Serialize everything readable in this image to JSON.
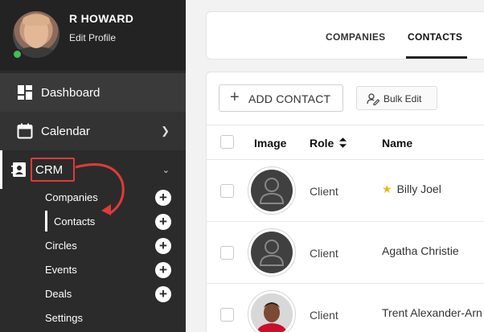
{
  "profile": {
    "name": "R HOWARD",
    "edit_label": "Edit Profile"
  },
  "nav": {
    "dashboard": "Dashboard",
    "calendar": "Calendar",
    "crm": "CRM",
    "sub_items": [
      "Companies",
      "Contacts",
      "Circles",
      "Events",
      "Deals",
      "Settings"
    ]
  },
  "tabs": {
    "companies": "COMPANIES",
    "contacts": "CONTACTS"
  },
  "toolbar": {
    "add_contact": "ADD CONTACT",
    "bulk_edit": "Bulk Edit"
  },
  "table": {
    "columns": [
      "Image",
      "Role",
      "Name"
    ],
    "rows": [
      {
        "role": "Client",
        "name": "Billy Joel",
        "starred": true
      },
      {
        "role": "Client",
        "name": "Agatha Christie",
        "starred": false
      },
      {
        "role": "Client",
        "name": "Trent Alexander-Arn",
        "starred": false
      }
    ]
  },
  "colors": {
    "sidebar": "#2b2b2b",
    "highlight": "#e03a3a",
    "star": "#f5b21b",
    "online": "#3fbf5a"
  },
  "icons": [
    "dashboard-icon",
    "calendar-icon",
    "crm-contact-icon",
    "chevron-right-icon",
    "chevron-down-icon",
    "plus-icon",
    "bulk-edit-icon",
    "sort-icon",
    "star-icon",
    "person-placeholder-icon"
  ]
}
